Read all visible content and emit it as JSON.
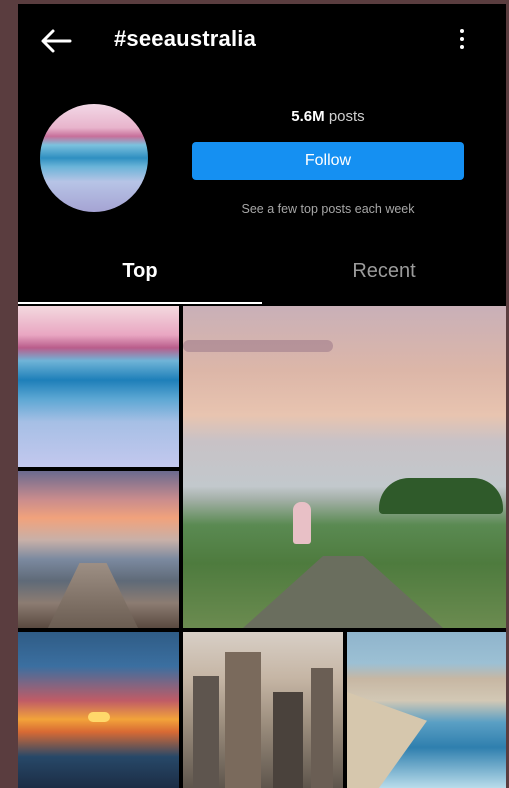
{
  "header": {
    "back_icon": "back-arrow-icon",
    "title": "#seeaustralia",
    "more_icon": "more-vertical-icon"
  },
  "profile": {
    "posts_count": "5.6M",
    "posts_label": "posts",
    "follow_label": "Follow",
    "subtitle": "See a few top posts each week"
  },
  "tabs": [
    {
      "label": "Top",
      "active": true
    },
    {
      "label": "Recent",
      "active": false
    }
  ],
  "colors": {
    "background": "#000000",
    "follow_button": "#1590f2",
    "outer_frame": "#5a3d3f"
  }
}
